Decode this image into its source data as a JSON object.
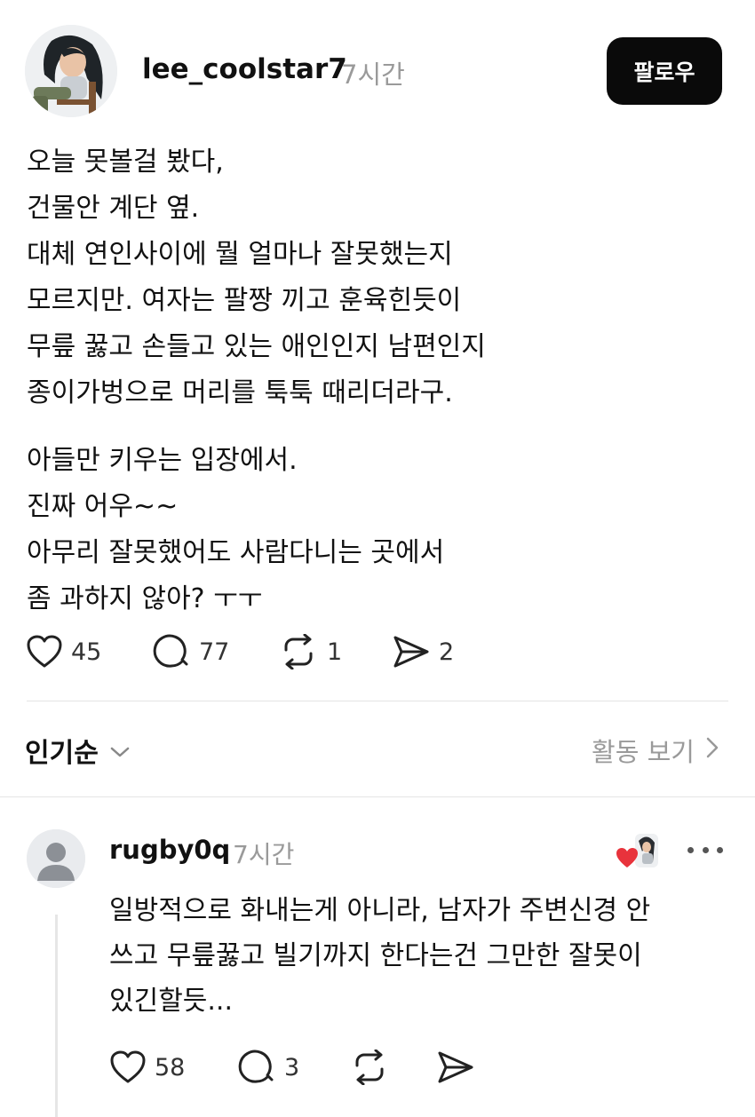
{
  "post": {
    "username": "lee_coolstar7",
    "time": "7시간",
    "follow_label": "팔로우",
    "body_lines": [
      "오늘 못볼걸 봤다,",
      "건물안 계단 옆.",
      "대체 연인사이에 뭘 얼마나 잘못했는지",
      "모르지만. 여자는 팔짱 끼고 훈육힌듯이",
      "무릎 꿇고 손들고 있는 애인인지 남편인지",
      "종이가벙으로 머리를 툭툭 때리더라구."
    ],
    "body_lines_2": [
      "아들만 키우는 입장에서.",
      "진짜 어우~~",
      "아무리 잘못했어도 사람다니는 곳에서",
      "좀 과하지 않아?  ㅜㅜ"
    ],
    "actions": {
      "likes": "45",
      "comments": "77",
      "reposts": "1",
      "shares": "2"
    }
  },
  "sort": {
    "label": "인기순",
    "activity_label": "활동 보기"
  },
  "comment": {
    "username": "rugby0q",
    "time": "7시간",
    "text_lines": [
      "일방적으로 화내는게 아니라, 남자가 주변신경 안",
      "쓰고 무릎꿇고 빌기까지 한다는건 그만한 잘못이",
      "있긴할듯..."
    ],
    "actions": {
      "likes": "58",
      "comments": "3"
    }
  },
  "icons": {
    "like": "heart-outline-icon",
    "comment": "speech-bubble-icon",
    "repost": "repost-arrows-icon",
    "share": "send-arrow-icon",
    "sort": "chevron-down-icon",
    "activity": "chevron-right-icon",
    "more": "more-dots-icon",
    "liked_badge": "red-heart-icon"
  },
  "colors": {
    "follow_bg": "#0a0a0a",
    "muted_text": "#9a9a9a",
    "liked_heart": "#e8333c"
  }
}
